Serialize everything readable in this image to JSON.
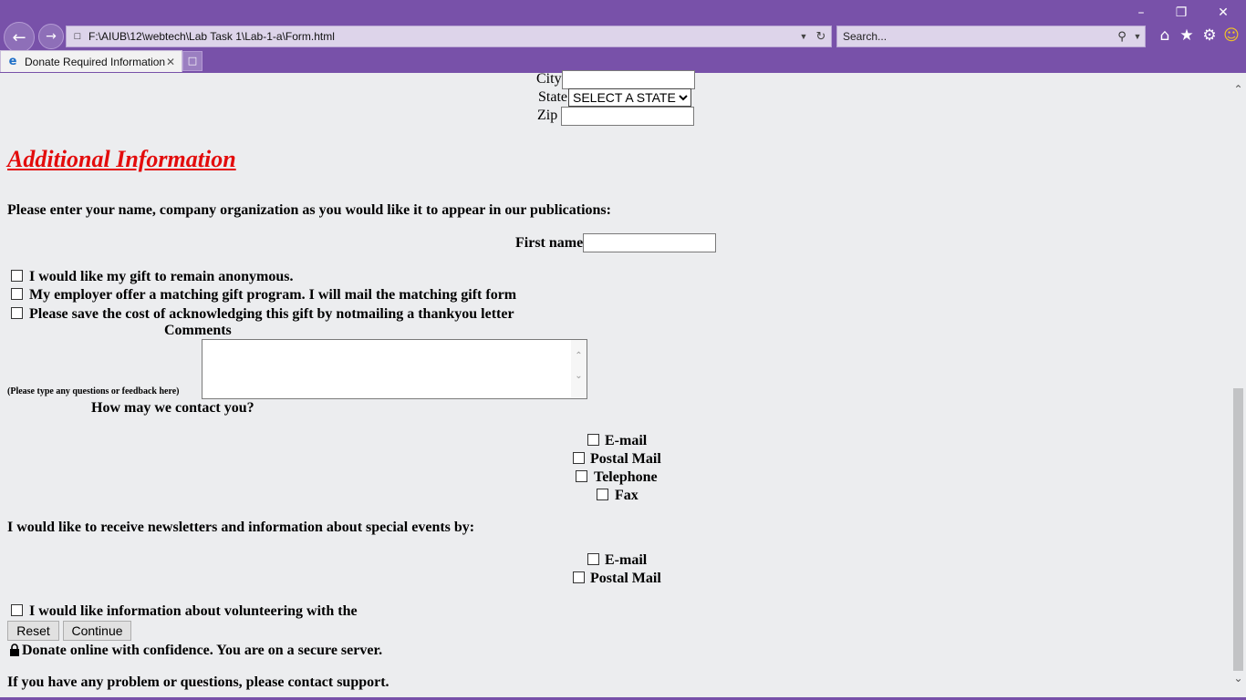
{
  "browser": {
    "address_url": "F:\\AIUB\\12\\webtech\\Lab Task 1\\Lab-1-a\\Form.html",
    "search_placeholder": "Search...",
    "tab_title": "Donate Required Information",
    "icons": [
      "back-arrow-icon",
      "forward-arrow-icon",
      "refresh-icon",
      "search-icon",
      "home-icon",
      "star-icon",
      "gear-icon",
      "smiley-icon"
    ],
    "colors": {
      "chrome": "#7851a9",
      "heading": "#e30c0c"
    }
  },
  "address_section": {
    "city_label": "City",
    "state_label": "State",
    "state_selected": "SELECT A STATE",
    "zip_label": "Zip"
  },
  "additional": {
    "heading": "Additional Information",
    "instructions": "Please enter your name, company organization as you would like it to appear in our publications:",
    "first_name_label": "First name",
    "options": [
      {
        "label": "I would like my gift to remain anonymous.",
        "checked": false
      },
      {
        "label": "My employer offer a matching gift program. I will mail the matching gift form",
        "checked": false
      },
      {
        "label": "Please save the cost of acknowledging this gift by notmailing a thankyou letter",
        "checked": false
      }
    ],
    "comments_label": "Comments",
    "comments_hint": "(Please type any questions or feedback here)",
    "contact_question": "How may we contact you?",
    "contact_options": [
      {
        "label": "E-mail",
        "checked": false
      },
      {
        "label": "Postal Mail",
        "checked": false
      },
      {
        "label": "Telephone",
        "checked": false
      },
      {
        "label": "Fax",
        "checked": false
      }
    ],
    "newsletter_text": "I would like to receive newsletters and information about special events by:",
    "newsletter_options": [
      {
        "label": "E-mail",
        "checked": false
      },
      {
        "label": "Postal Mail",
        "checked": false
      }
    ],
    "volunteer_label": "I would like information about volunteering with the",
    "reset_label": "Reset",
    "continue_label": "Continue",
    "secure_text": "Donate online with confidence. You are on a secure server.",
    "support_text": "If you have any problem or questions, please contact support."
  }
}
